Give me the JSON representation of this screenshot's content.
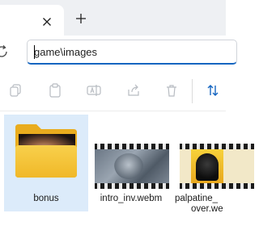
{
  "window": {
    "tab_close_icon": "close-icon",
    "new_tab_icon": "plus-icon"
  },
  "address_bar": {
    "path": "game\\images",
    "refresh_icon": "refresh-icon"
  },
  "command_bar": {
    "buttons": [
      {
        "icon": "copy-icon"
      },
      {
        "icon": "paste-icon"
      },
      {
        "icon": "rename-icon"
      },
      {
        "icon": "share-icon"
      },
      {
        "icon": "delete-icon"
      },
      {
        "icon": "sort-icon"
      }
    ]
  },
  "files": [
    {
      "name": "bonus",
      "type": "folder",
      "selected": true
    },
    {
      "name": "intro_inv.webm",
      "type": "video"
    },
    {
      "name": "palpatine_over.webm",
      "line1": "palpatine_",
      "line2": "over.we",
      "type": "video"
    }
  ],
  "colors": {
    "accent": "#1565c0",
    "selection": "#dcebfa",
    "folder": "#f4c436"
  }
}
